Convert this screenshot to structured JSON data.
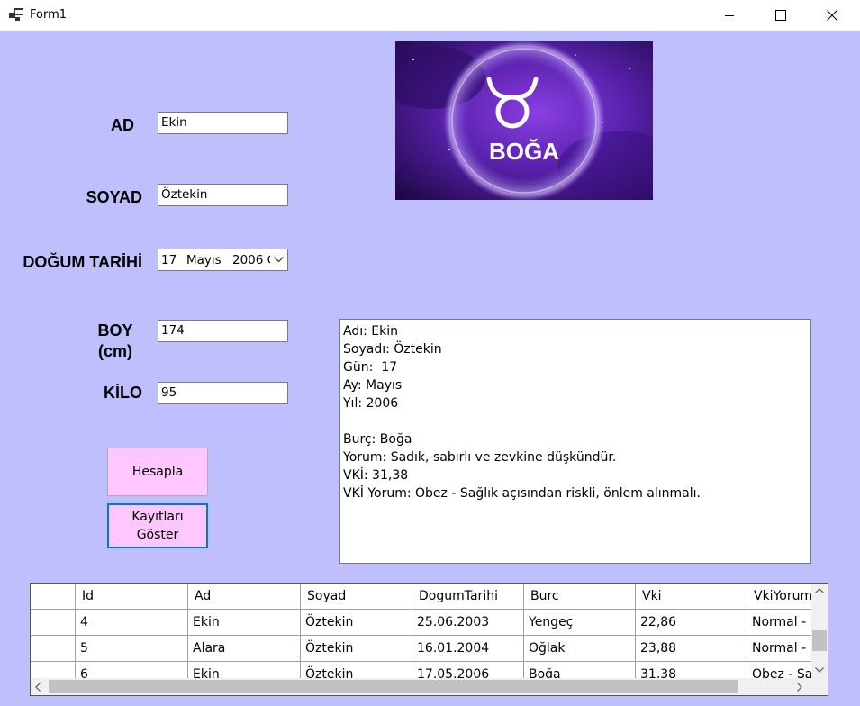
{
  "window": {
    "title": "Form1",
    "icons": {
      "app": "app-window-icon",
      "minimize": "minimize-icon",
      "maximize": "maximize-icon",
      "close": "close-icon"
    }
  },
  "form": {
    "ad_label": "AD",
    "ad_value": "Ekin",
    "soyad_label": "SOYAD",
    "soyad_value": "Öztekin",
    "dogum_label": "DOĞUM TARİHİ",
    "dogum_day": "17",
    "dogum_month": "Mayıs",
    "dogum_year": "2006 Ç",
    "boy_label_line1": "BOY",
    "boy_label_line2": "(cm)",
    "boy_value": "174",
    "kilo_label": "KİLO",
    "kilo_value": "95",
    "hesapla_button": "Hesapla",
    "kayitlar_button_line1": "Kayıtları",
    "kayitlar_button_line2": "Göster"
  },
  "zodiac_image": {
    "label": "BOĞA",
    "icon": "taurus-icon",
    "colors": {
      "bg_dark": "#2a0a5a",
      "bg_mid": "#6a2fc0",
      "accent": "#ffffff"
    }
  },
  "result_lines": [
    "Adı: Ekin",
    "Soyadı: Öztekin",
    "Gün:  17",
    "Ay: Mayıs",
    "Yıl: 2006",
    "",
    "Burç: Boğa",
    "Yorum: Sadık, sabırlı ve zevkine düşkündür.",
    "VKİ: 31,38",
    "VKİ Yorum: Obez - Sağlık açısından riskli, önlem alınmalı."
  ],
  "grid": {
    "columns": [
      "Id",
      "Ad",
      "Soyad",
      "DogumTarihi",
      "Burc",
      "Vki",
      "VkiYorum"
    ],
    "rows": [
      [
        "4",
        "Ekin",
        "Öztekin",
        "25.06.2003",
        "Yengeç",
        "22,86",
        "Normal - "
      ],
      [
        "5",
        "Alara",
        "Öztekin",
        "16.01.2004",
        "Oğlak",
        "23,88",
        "Normal - "
      ],
      [
        "6",
        "Ekin",
        "Öztekin",
        "17.05.2006",
        "Boğa",
        "31,38",
        "Obez - Sa"
      ]
    ]
  },
  "colors": {
    "form_bg": "#bfbffe",
    "button_bg": "#ffc6ff",
    "button_focus_border": "#0078d7"
  }
}
